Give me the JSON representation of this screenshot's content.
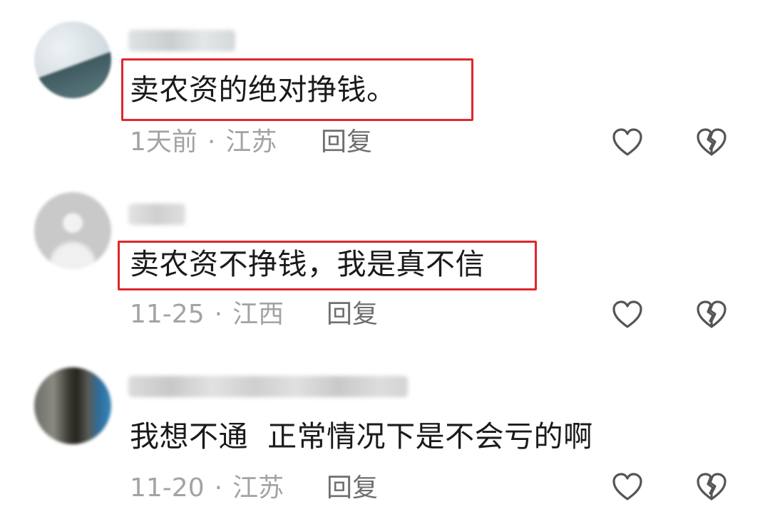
{
  "comments": [
    {
      "text": "卖农资的绝对挣钱。",
      "time": "1天前",
      "location": "江苏",
      "separator": "·",
      "reply_label": "回复",
      "highlighted": true
    },
    {
      "text": "卖农资不挣钱，我是真不信",
      "time": "11-25",
      "location": "江西",
      "separator": "·",
      "reply_label": "回复",
      "highlighted": true
    },
    {
      "text": "我想不通  正常情况下是不会亏的啊",
      "time": "11-20",
      "location": "江苏",
      "separator": "·",
      "reply_label": "回复",
      "highlighted": false
    }
  ],
  "colors": {
    "highlight_border": "#e0262c",
    "meta_text": "#a3a3a3",
    "reply_text": "#6f6f6f",
    "icon_stroke": "#555555"
  },
  "icons": {
    "like": "heart-outline-icon",
    "dislike": "broken-heart-outline-icon"
  }
}
